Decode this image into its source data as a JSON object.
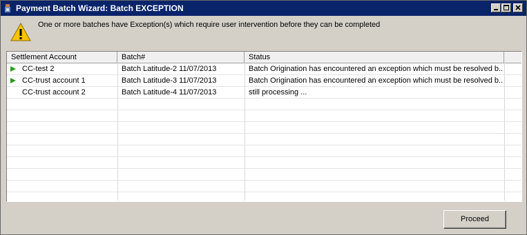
{
  "window": {
    "title": "Payment Batch Wizard: Batch EXCEPTION"
  },
  "message": "One or more batches have Exception(s) which require user intervention before they can be completed",
  "grid": {
    "columns": [
      "Settlement Account",
      "Batch#",
      "Status"
    ],
    "rows": [
      {
        "account": "CC-test 2",
        "batch": "Batch Latitude-2 11/07/2013",
        "status": "Batch Origination has encountered an exception which must be resolved b...",
        "icon": "play-icon"
      },
      {
        "account": "CC-trust account 1",
        "batch": "Batch Latitude-3 11/07/2013",
        "status": "Batch Origination has encountered an exception which must be resolved b...",
        "icon": "play-icon"
      },
      {
        "account": "CC-trust account 2",
        "batch": "Batch Latitude-4 11/07/2013",
        "status": "still processing ...",
        "icon": ""
      }
    ]
  },
  "buttons": {
    "proceed": "Proceed"
  },
  "colors": {
    "titlebar": "#0a246a",
    "play_icon": "#2a9a20",
    "warning": "#f6c400"
  }
}
